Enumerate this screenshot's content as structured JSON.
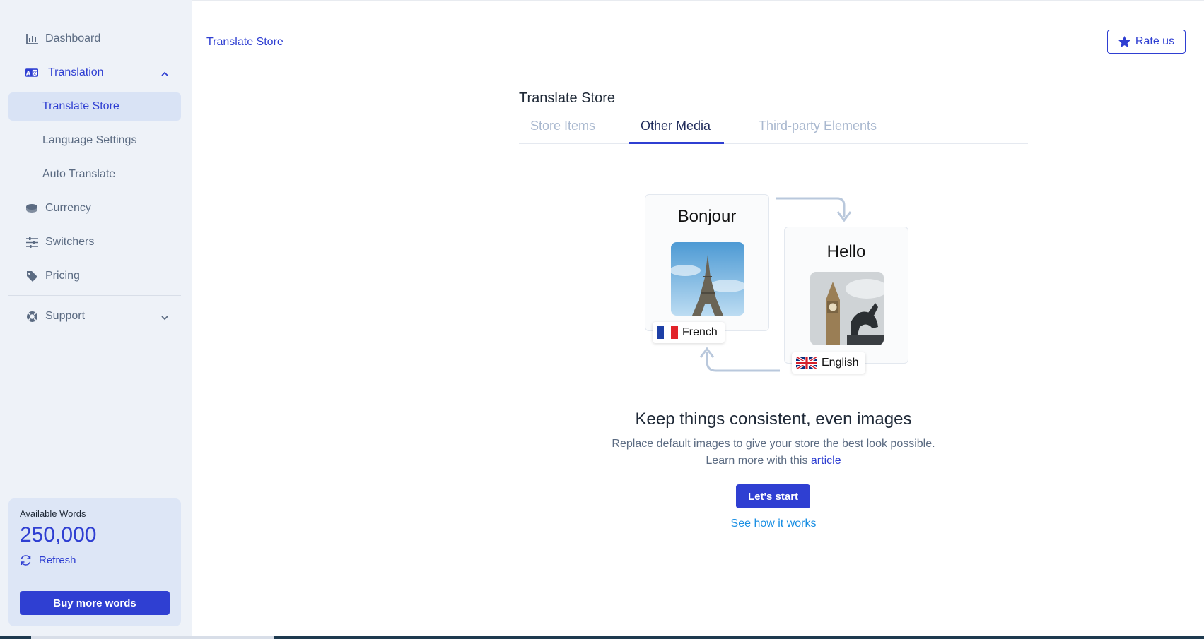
{
  "sidebar": {
    "nav": {
      "dashboard": "Dashboard",
      "translation": "Translation",
      "translate_store": "Translate Store",
      "language_settings": "Language Settings",
      "auto_translate": "Auto Translate",
      "currency": "Currency",
      "switchers": "Switchers",
      "pricing": "Pricing",
      "support": "Support"
    },
    "words_card": {
      "label": "Available Words",
      "value": "250,000",
      "refresh": "Refresh",
      "buy": "Buy more words"
    }
  },
  "header": {
    "breadcrumb": "Translate Store",
    "rate": "Rate us"
  },
  "main": {
    "title": "Translate Store",
    "tabs": [
      "Store Items",
      "Other Media",
      "Third-party Elements"
    ],
    "active_tab": "Other Media",
    "illustration": {
      "source_word": "Bonjour",
      "target_word": "Hello",
      "source_lang": "French",
      "target_lang": "English"
    },
    "headline": "Keep things consistent, even images",
    "desc_line1": "Replace default images to give your store the best look possible.",
    "desc_line2_prefix": "Learn more with this",
    "desc_link": "article",
    "cta": "Let's start",
    "secondary": "See how it works"
  },
  "colors": {
    "accent": "#2f3fd2",
    "sidebar_bg": "#eef2f8",
    "link": "#1a8fe3"
  }
}
